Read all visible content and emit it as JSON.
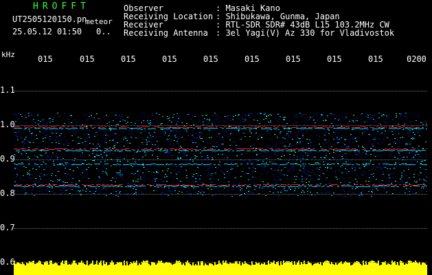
{
  "header": {
    "brand": "HROFFT",
    "filename": "UT2505120150.pn",
    "mode": "meteor",
    "datetime": "25.05.12 01:50",
    "count": "0..",
    "fields": [
      {
        "label": "Observer",
        "value": ": Masaki Kano"
      },
      {
        "label": "Receiving Location",
        "value": ": Shibukawa, Gunma, Japan"
      },
      {
        "label": "Receiver",
        "value": ": RTL-SDR SDR# 43dB L15 103.2MHz CW"
      },
      {
        "label": "Receiving Antenna",
        "value": ": 3el Yagi(V) Az 330 for Vladivostok"
      }
    ]
  },
  "axis": {
    "unit": "kHz",
    "y_ticks": [
      "1.1",
      "1.0",
      "0.9",
      "0.8",
      "0.7",
      "0.6"
    ],
    "x_ticks": [
      "015",
      "015",
      "015",
      "015",
      "015",
      "015",
      "015",
      "015",
      "015",
      "0200"
    ]
  },
  "colors": {
    "background": "#000000",
    "header_text": "#ffffff",
    "brand": "#33ff33",
    "noise_floor": "#ffff00",
    "signal_low": "#0a1aa0",
    "signal_mid": "#00d0ff",
    "signal_high": "#ff2020"
  }
}
